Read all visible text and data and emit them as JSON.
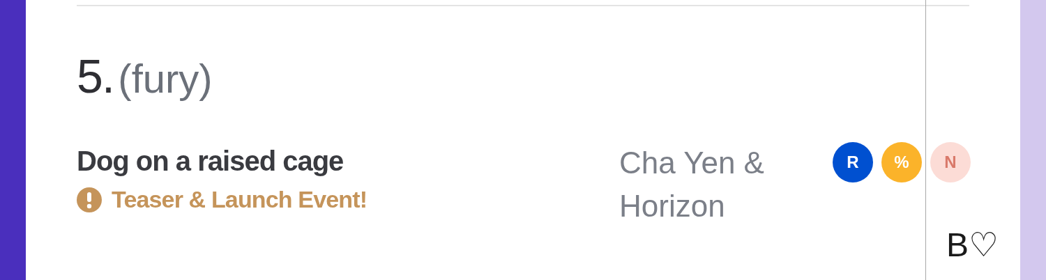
{
  "entry": {
    "number": "5.",
    "tag": "(fury)",
    "title": "Dog on a raised cage",
    "notice": "Teaser & Launch Event!",
    "artist": "Cha Yen & Horizon",
    "platforms": [
      {
        "letter": "R",
        "color": "#0050d0"
      },
      {
        "letter": "%",
        "color": "#fbb32a"
      },
      {
        "letter": "N",
        "color": "#fcdcd6"
      }
    ]
  },
  "side_label": "B♡"
}
